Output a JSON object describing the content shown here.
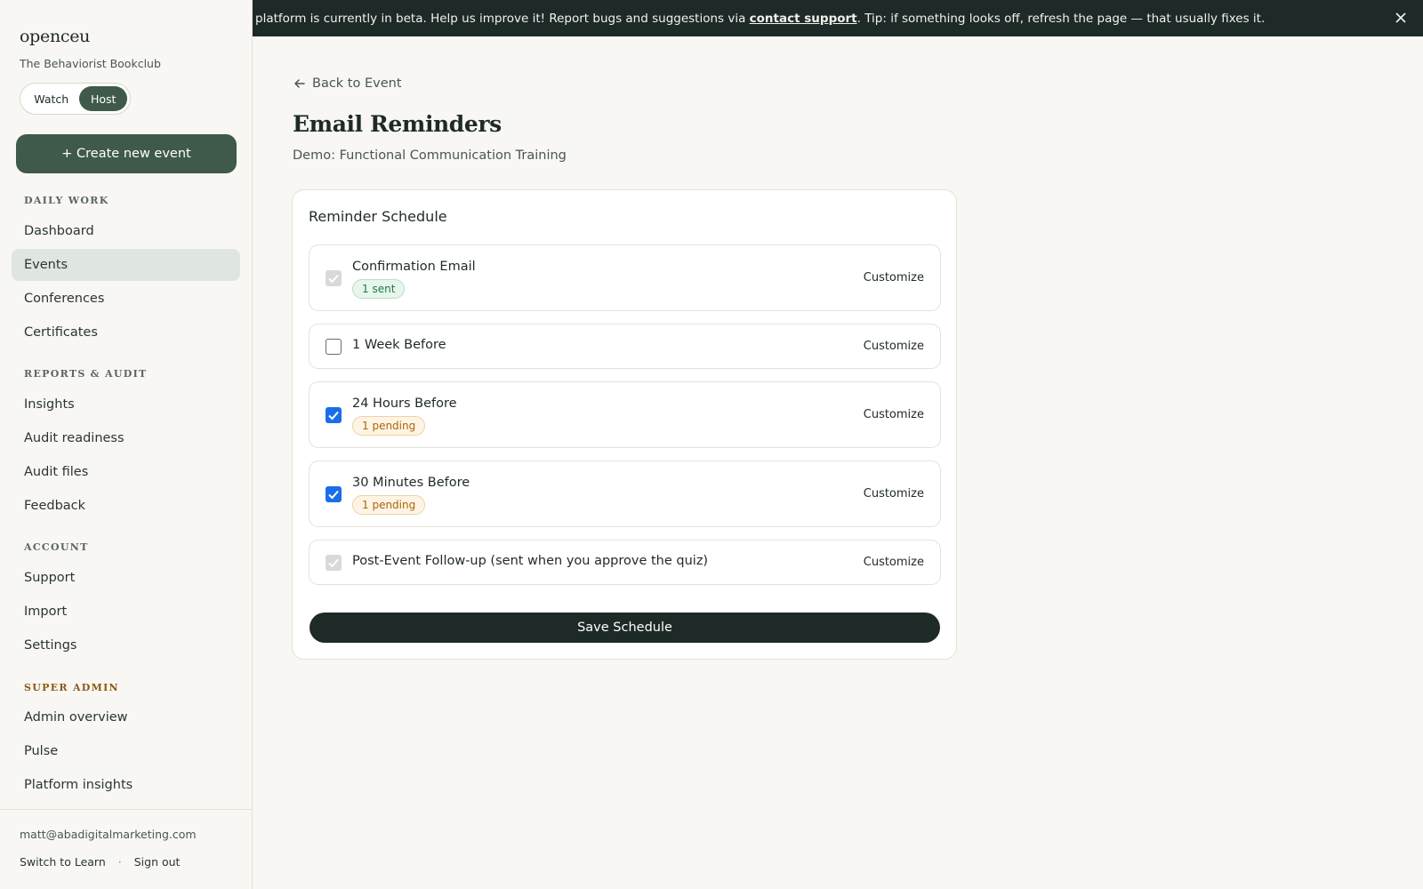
{
  "sidebar": {
    "brand": "openceu",
    "org": "The Behaviorist Bookclub",
    "toggle": {
      "watch": "Watch",
      "host": "Host",
      "selected": "Host"
    },
    "create_label": "+ Create new event",
    "sections": [
      {
        "heading": "DAILY WORK",
        "items": [
          "Dashboard",
          "Events",
          "Conferences",
          "Certificates"
        ]
      },
      {
        "heading": "REPORTS & AUDIT",
        "items": [
          "Insights",
          "Audit readiness",
          "Audit files",
          "Feedback"
        ]
      },
      {
        "heading": "ACCOUNT",
        "items": [
          "Support",
          "Import",
          "Settings"
        ]
      },
      {
        "heading": "SUPER ADMIN",
        "items": [
          "Admin overview",
          "Pulse",
          "Platform insights"
        ]
      }
    ],
    "active_item": "Events",
    "email": "matt@abadigitalmarketing.com",
    "switch_label": "Switch to Learn",
    "separator": "·",
    "signout_label": "Sign out"
  },
  "banner": {
    "text_before": "platform is currently in beta. Help us improve it! Report bugs and suggestions via ",
    "link_text": "contact support",
    "text_after": ". Tip: if something looks off, refresh the page — that usually fixes it."
  },
  "main": {
    "back_label": "Back to Event",
    "title": "Email Reminders",
    "subtitle": "Demo: Functional Communication Training",
    "card_title": "Reminder Schedule",
    "reminders": [
      {
        "label": "Confirmation Email",
        "state": "disabled-checked",
        "badge": "1 sent",
        "badge_type": "sent",
        "action": "Customize"
      },
      {
        "label": "1 Week Before",
        "state": "unchecked",
        "badge": null,
        "badge_type": null,
        "action": "Customize"
      },
      {
        "label": "24 Hours Before",
        "state": "checked",
        "badge": "1 pending",
        "badge_type": "pending",
        "action": "Customize"
      },
      {
        "label": "30 Minutes Before",
        "state": "checked",
        "badge": "1 pending",
        "badge_type": "pending",
        "action": "Customize"
      },
      {
        "label": "Post-Event Follow-up (sent when you approve the quiz)",
        "state": "disabled-checked",
        "badge": null,
        "badge_type": null,
        "action": "Customize"
      }
    ],
    "save_label": "Save Schedule"
  },
  "colors": {
    "accent_green": "#3f5a4a",
    "banner_bg": "#1e2a27",
    "checkbox_blue": "#1a6ee8",
    "super_admin_heading": "#8a5a12"
  }
}
